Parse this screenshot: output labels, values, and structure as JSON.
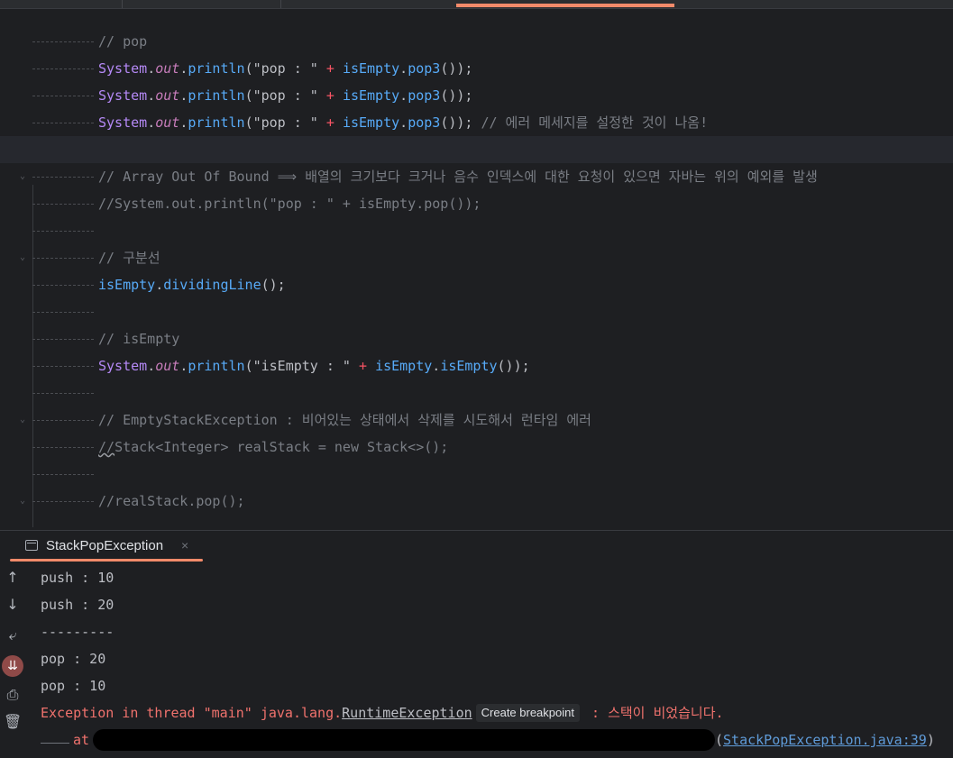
{
  "editor": {
    "lines": [
      {
        "tokens": [
          {
            "t": "// pop",
            "c": "c-comment"
          }
        ]
      },
      {
        "tokens": [
          {
            "t": "System",
            "c": "c-class"
          },
          {
            "t": ".",
            "c": "c-plain"
          },
          {
            "t": "out",
            "c": "c-field"
          },
          {
            "t": ".",
            "c": "c-plain"
          },
          {
            "t": "println",
            "c": "c-method"
          },
          {
            "t": "(",
            "c": "c-plain"
          },
          {
            "t": "\"pop : \"",
            "c": "c-plain"
          },
          {
            "t": " + ",
            "c": "c-op"
          },
          {
            "t": "isEmpty",
            "c": "c-var"
          },
          {
            "t": ".",
            "c": "c-plain"
          },
          {
            "t": "pop3",
            "c": "c-method"
          },
          {
            "t": "());",
            "c": "c-plain"
          }
        ]
      },
      {
        "tokens": [
          {
            "t": "System",
            "c": "c-class"
          },
          {
            "t": ".",
            "c": "c-plain"
          },
          {
            "t": "out",
            "c": "c-field"
          },
          {
            "t": ".",
            "c": "c-plain"
          },
          {
            "t": "println",
            "c": "c-method"
          },
          {
            "t": "(",
            "c": "c-plain"
          },
          {
            "t": "\"pop : \"",
            "c": "c-plain"
          },
          {
            "t": " + ",
            "c": "c-op"
          },
          {
            "t": "isEmpty",
            "c": "c-var"
          },
          {
            "t": ".",
            "c": "c-plain"
          },
          {
            "t": "pop3",
            "c": "c-method"
          },
          {
            "t": "());",
            "c": "c-plain"
          }
        ]
      },
      {
        "tokens": [
          {
            "t": "System",
            "c": "c-class"
          },
          {
            "t": ".",
            "c": "c-plain"
          },
          {
            "t": "out",
            "c": "c-field"
          },
          {
            "t": ".",
            "c": "c-plain"
          },
          {
            "t": "println",
            "c": "c-method"
          },
          {
            "t": "(",
            "c": "c-plain"
          },
          {
            "t": "\"pop : \"",
            "c": "c-plain"
          },
          {
            "t": " + ",
            "c": "c-op"
          },
          {
            "t": "isEmpty",
            "c": "c-var"
          },
          {
            "t": ".",
            "c": "c-plain"
          },
          {
            "t": "pop3",
            "c": "c-method"
          },
          {
            "t": "());",
            "c": "c-plain"
          },
          {
            "t": " // 에러 메세지를 설정한 것이 나옴!",
            "c": "c-comment"
          }
        ]
      },
      {
        "tokens": [],
        "current": true
      },
      {
        "tokens": [
          {
            "t": "// Array Out Of Bound ⟹ 배열의 크기보다 크거나 음수 인덱스에 대한 요청이 있으면 자바는 위의 예외를 발생",
            "c": "c-comment"
          }
        ],
        "fold": true
      },
      {
        "tokens": [
          {
            "t": "//System.out.println(\"pop : \" + isEmpty.pop());",
            "c": "c-comment"
          }
        ]
      },
      {
        "tokens": []
      },
      {
        "tokens": [
          {
            "t": "// 구분선",
            "c": "c-comment"
          }
        ],
        "fold": true
      },
      {
        "tokens": [
          {
            "t": "isEmpty",
            "c": "c-var"
          },
          {
            "t": ".",
            "c": "c-plain"
          },
          {
            "t": "dividingLine",
            "c": "c-method"
          },
          {
            "t": "();",
            "c": "c-plain"
          }
        ]
      },
      {
        "tokens": []
      },
      {
        "tokens": [
          {
            "t": "// isEmpty",
            "c": "c-comment"
          }
        ]
      },
      {
        "tokens": [
          {
            "t": "System",
            "c": "c-class"
          },
          {
            "t": ".",
            "c": "c-plain"
          },
          {
            "t": "out",
            "c": "c-field"
          },
          {
            "t": ".",
            "c": "c-plain"
          },
          {
            "t": "println",
            "c": "c-method"
          },
          {
            "t": "(",
            "c": "c-plain"
          },
          {
            "t": "\"isEmpty : \"",
            "c": "c-plain"
          },
          {
            "t": " + ",
            "c": "c-op"
          },
          {
            "t": "isEmpty",
            "c": "c-var"
          },
          {
            "t": ".",
            "c": "c-plain"
          },
          {
            "t": "isEmpty",
            "c": "c-method"
          },
          {
            "t": "());",
            "c": "c-plain"
          }
        ]
      },
      {
        "tokens": []
      },
      {
        "tokens": [
          {
            "t": "// EmptyStackException : 비어있는 상태에서 삭제를 시도해서 런타임 에러",
            "c": "c-comment"
          }
        ],
        "fold": true
      },
      {
        "tokens": [
          {
            "t": "//",
            "c": "c-comment squig"
          },
          {
            "t": "Stack<Integer> realStack = new Stack<>();",
            "c": "c-comment"
          }
        ]
      },
      {
        "tokens": []
      },
      {
        "tokens": [
          {
            "t": "//realStack.pop();",
            "c": "c-comment"
          }
        ],
        "fold": true
      }
    ]
  },
  "run_panel": {
    "tab_label": "StackPopException",
    "close_glyph": "×"
  },
  "console": {
    "lines": [
      "push : 10",
      "push : 20",
      "---------",
      "pop : 20",
      "pop : 10"
    ],
    "error": {
      "prefix": "Exception in thread \"main\" java.lang.",
      "exception": "RuntimeException",
      "tooltip": "Create breakpoint",
      "suffix": " : 스택이 비었습니다."
    },
    "stack": {
      "at": "at",
      "open_paren": "(",
      "link": "StackPopException.java:39",
      "close_paren": ")"
    }
  },
  "gutter_icons": [
    {
      "name": "arrow-up-icon",
      "glyph": "↑"
    },
    {
      "name": "arrow-down-icon",
      "glyph": "↓"
    },
    {
      "name": "soft-wrap-icon",
      "glyph": "⤶"
    },
    {
      "name": "scroll-to-end-icon",
      "glyph": "⇊"
    },
    {
      "name": "print-icon",
      "glyph": "⎙"
    },
    {
      "name": "trash-icon",
      "glyph": "🗑"
    }
  ]
}
